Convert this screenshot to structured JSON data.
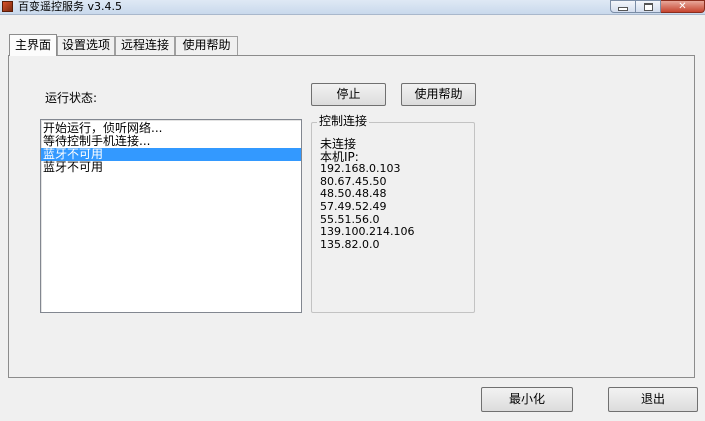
{
  "window": {
    "title": "百变遥控服务 v3.4.5",
    "controls": {
      "minimize_icon": "minimize-icon",
      "maximize_icon": "maximize-icon",
      "close_icon": "close-icon"
    }
  },
  "tabs": [
    {
      "label": "主界面",
      "active": true
    },
    {
      "label": "设置选项",
      "active": false
    },
    {
      "label": "远程连接",
      "active": false
    },
    {
      "label": "使用帮助",
      "active": false
    }
  ],
  "main": {
    "status_label": "运行状态:",
    "log": [
      {
        "text": "开始运行，侦听网络...",
        "selected": false
      },
      {
        "text": "等待控制手机连接...",
        "selected": false
      },
      {
        "text": "蓝牙不可用",
        "selected": true
      },
      {
        "text": "蓝牙不可用",
        "selected": false
      }
    ],
    "stop_button": "停止",
    "help_button": "使用帮助",
    "control": {
      "title": "控制连接",
      "status": "未连接",
      "ip_label": "本机IP:",
      "ips": [
        "192.168.0.103",
        "80.67.45.50",
        "48.50.48.48",
        "57.49.52.49",
        "55.51.56.0",
        "139.100.214.106",
        "135.82.0.0"
      ]
    }
  },
  "footer": {
    "minimize_button": "最小化",
    "exit_button": "退出"
  },
  "colors": {
    "selection": "#3399ff",
    "window_bg": "#f0f0f0"
  }
}
